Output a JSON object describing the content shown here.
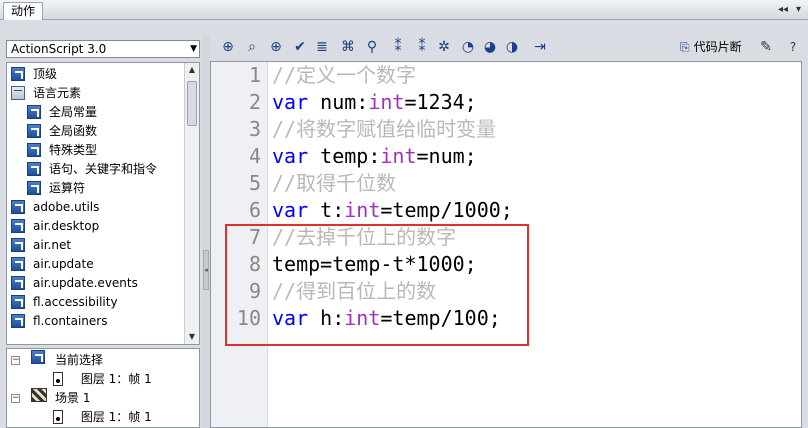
{
  "window": {
    "title": "动作",
    "controls": [
      "◂◂",
      "▾"
    ]
  },
  "left_panel": {
    "version_select": {
      "value": "ActionScript 3.0"
    },
    "tree_items": [
      {
        "label": "顶级",
        "indent": 0,
        "open": false
      },
      {
        "label": "语言元素",
        "indent": 0,
        "open": true
      },
      {
        "label": "全局常量",
        "indent": 1,
        "open": false
      },
      {
        "label": "全局函数",
        "indent": 1,
        "open": false
      },
      {
        "label": "特殊类型",
        "indent": 1,
        "open": false
      },
      {
        "label": "语句、关键字和指令",
        "indent": 1,
        "open": false
      },
      {
        "label": "运算符",
        "indent": 1,
        "open": false
      },
      {
        "label": "adobe.utils",
        "indent": 0,
        "open": false
      },
      {
        "label": "air.desktop",
        "indent": 0,
        "open": false
      },
      {
        "label": "air.net",
        "indent": 0,
        "open": false
      },
      {
        "label": "air.update",
        "indent": 0,
        "open": false
      },
      {
        "label": "air.update.events",
        "indent": 0,
        "open": false
      },
      {
        "label": "fl.accessibility",
        "indent": 0,
        "open": false
      },
      {
        "label": "fl.containers",
        "indent": 0,
        "open": false
      }
    ],
    "bottom_tree": [
      {
        "label": "当前选择"
      },
      {
        "label": "图层 1：帧 1"
      },
      {
        "label": "场景 1"
      },
      {
        "label": "图层 1：帧 1"
      }
    ]
  },
  "toolbar": {
    "icons": [
      "add-icon",
      "find-icon",
      "target-icon",
      "check-syntax-icon",
      "auto-format-icon",
      "code-hint-icon",
      "debug-icon",
      "collapse-between-icon",
      "collapse-selection-icon",
      "expand-all-icon",
      "comment-block-icon",
      "comment-line-icon",
      "uncomment-icon",
      "show-hide-toolbox-icon"
    ],
    "snippets_label": "代码片断",
    "help_icon": "?"
  },
  "editor": {
    "lines": [
      {
        "num": "1",
        "tokens": [
          {
            "t": "//定义一个数字",
            "c": "cm"
          }
        ]
      },
      {
        "num": "2",
        "tokens": [
          {
            "t": "var",
            "c": "kw"
          },
          {
            "t": " num:",
            "c": "tx"
          },
          {
            "t": "int",
            "c": "ty"
          },
          {
            "t": "=1234;",
            "c": "tx"
          }
        ]
      },
      {
        "num": "3",
        "tokens": [
          {
            "t": "//将数字赋值给临时变量",
            "c": "cm"
          }
        ]
      },
      {
        "num": "4",
        "tokens": [
          {
            "t": "var",
            "c": "kw"
          },
          {
            "t": " temp:",
            "c": "tx"
          },
          {
            "t": "int",
            "c": "ty"
          },
          {
            "t": "=num;",
            "c": "tx"
          }
        ]
      },
      {
        "num": "5",
        "tokens": [
          {
            "t": "//取得千位数",
            "c": "cm"
          }
        ]
      },
      {
        "num": "6",
        "tokens": [
          {
            "t": "var",
            "c": "kw"
          },
          {
            "t": " t:",
            "c": "tx"
          },
          {
            "t": "int",
            "c": "ty"
          },
          {
            "t": "=temp/1000;",
            "c": "tx"
          }
        ]
      },
      {
        "num": "7",
        "tokens": [
          {
            "t": "//去掉千位上的数字",
            "c": "cm"
          }
        ]
      },
      {
        "num": "8",
        "tokens": [
          {
            "t": "temp=temp-t*1000;",
            "c": "tx"
          }
        ]
      },
      {
        "num": "9",
        "tokens": [
          {
            "t": "//得到百位上的数",
            "c": "cm"
          }
        ]
      },
      {
        "num": "10",
        "tokens": [
          {
            "t": "var",
            "c": "kw"
          },
          {
            "t": " h:",
            "c": "tx"
          },
          {
            "t": "int",
            "c": "ty"
          },
          {
            "t": "=temp/100;",
            "c": "tx"
          }
        ]
      }
    ],
    "colors": {
      "comment": "#b8b8b8",
      "keyword": "#0000ff",
      "type": "#a030c0",
      "highlight_box": "#e02f2f"
    }
  }
}
